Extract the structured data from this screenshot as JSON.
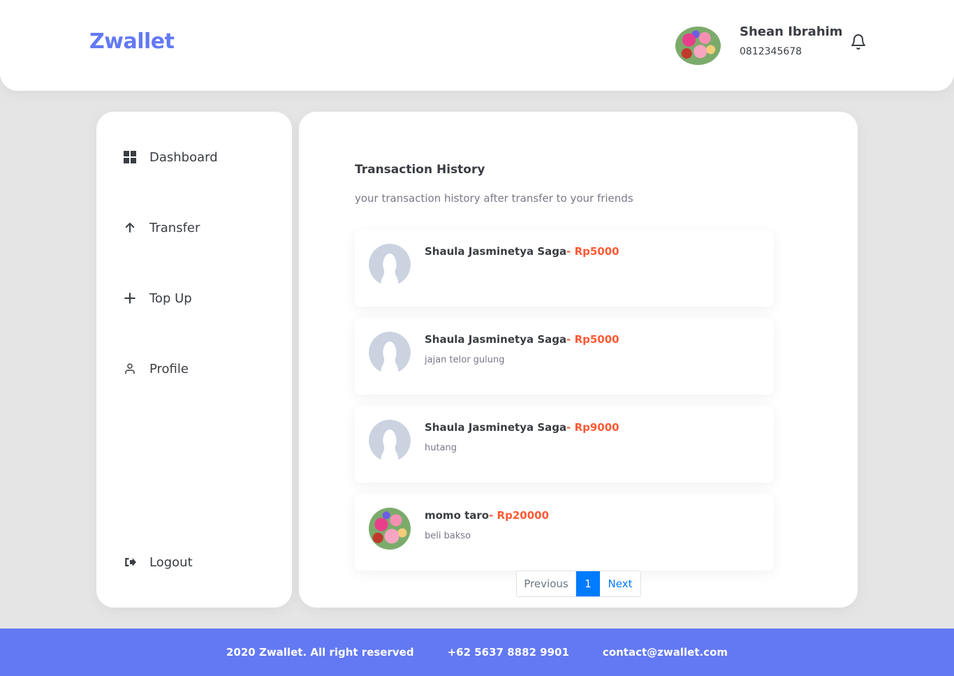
{
  "header": {
    "brand": "Zwallet",
    "user_name": "Shean Ibrahim",
    "user_phone": "0812345678"
  },
  "sidebar": {
    "items": [
      {
        "label": "Dashboard",
        "icon": "grid-icon"
      },
      {
        "label": "Transfer",
        "icon": "arrow-up-icon"
      },
      {
        "label": "Top Up",
        "icon": "plus-icon"
      },
      {
        "label": "Profile",
        "icon": "user-icon"
      }
    ],
    "logout": {
      "label": "Logout",
      "icon": "logout-icon"
    }
  },
  "main": {
    "title": "Transaction History",
    "subtitle": "your transaction history after transfer to your friends",
    "transactions": [
      {
        "name": "Shaula Jasminetya Saga",
        "amount": "Rp5000",
        "note": "",
        "avatar": "placeholder"
      },
      {
        "name": "Shaula Jasminetya Saga",
        "amount": "Rp5000",
        "note": "jajan telor gulung",
        "avatar": "placeholder"
      },
      {
        "name": "Shaula Jasminetya Saga",
        "amount": "Rp9000",
        "note": "hutang",
        "avatar": "placeholder"
      },
      {
        "name": "momo taro",
        "amount": "Rp20000",
        "note": "beli bakso",
        "avatar": "photo"
      }
    ],
    "pagination": {
      "prev": "Previous",
      "current": "1",
      "next": "Next"
    }
  },
  "footer": {
    "copyright": "2020 Zwallet. All right reserved",
    "phone": "+62 5637 8882 9901",
    "email": "contact@zwallet.com"
  },
  "colors": {
    "brand": "#6379f4",
    "amount": "#ff5b37",
    "page_active": "#007bff"
  }
}
